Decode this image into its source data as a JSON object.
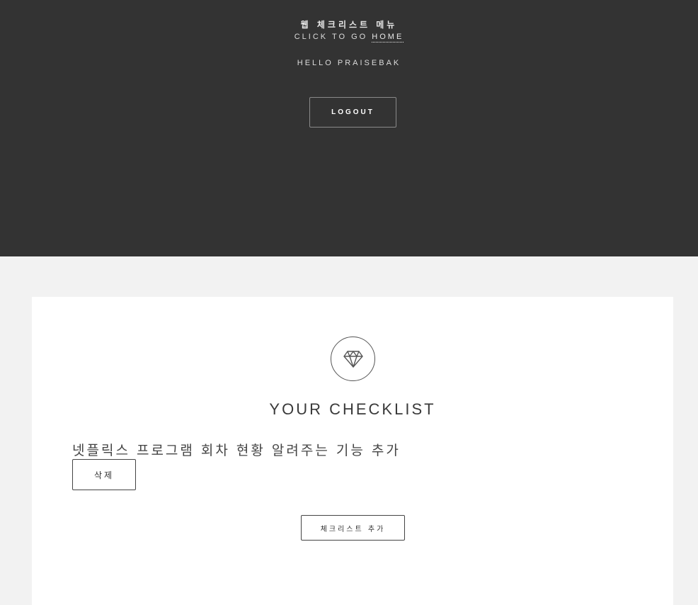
{
  "header": {
    "menu_title": "웹 체크리스트 메뉴",
    "home_prefix": "CLICK TO GO ",
    "home_link": "HOME",
    "greeting": "HELLO PRAISEBAK",
    "logout_label": "LOGOUT"
  },
  "main": {
    "icon": "diamond-icon",
    "title": "YOUR CHECKLIST",
    "items": [
      {
        "text": "넷플릭스 프로그램 회차 현황 알려주는 기능 추가",
        "delete_label": "삭제"
      }
    ],
    "add_label": "체크리스트 추가"
  },
  "colors": {
    "header_bg": "#333333",
    "page_bg": "#f2f2f2",
    "card_bg": "#ffffff"
  }
}
